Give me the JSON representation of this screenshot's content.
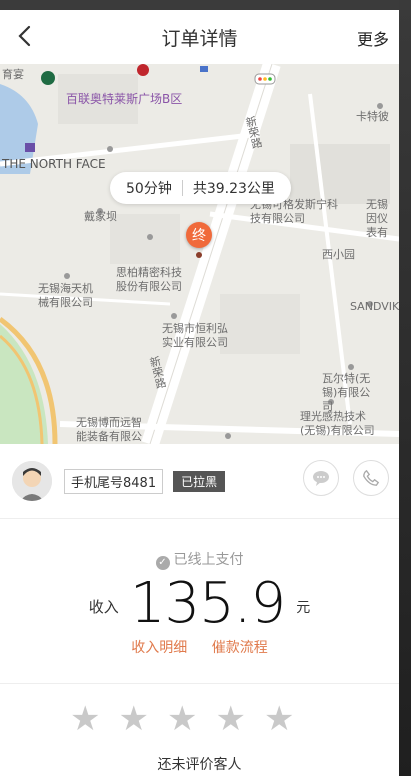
{
  "header": {
    "title": "订单详情",
    "more_label": "更多"
  },
  "map": {
    "labels": [
      "百联奥特莱斯广场B区",
      "THE NORTH FACE",
      "新荣路",
      "戴家坝",
      "思柏精密科技股份有限公司",
      "无锡海天机械有限公司",
      "无锡市恒利弘实业有限公司",
      "新荣路",
      "无锡博而远智能装备有限公司",
      "瓦尔特(无锡)有限公司",
      "理光感热技术(无锡)有限公司",
      "SANDVIK",
      "西小园",
      "卡特彼",
      "无锡可格发斯宁科技有限公司",
      "无锡因仪表有",
      "育宴"
    ],
    "route": {
      "time": "50分钟",
      "distance": "共39.23公里"
    },
    "end_marker": "终"
  },
  "driver": {
    "phone_tag": "手机尾号8481",
    "status_badge": "已拉黑"
  },
  "payment": {
    "status": "已线上支付",
    "income_label": "收入",
    "amount": "135.9",
    "unit": "元",
    "detail_link": "收入明细",
    "process_link": "催款流程"
  },
  "rating": {
    "stars_filled": 0,
    "stars_total": 5,
    "text": "还未评价客人"
  },
  "colors": {
    "accent": "#e07a4c",
    "pin": "#f06a3b"
  }
}
